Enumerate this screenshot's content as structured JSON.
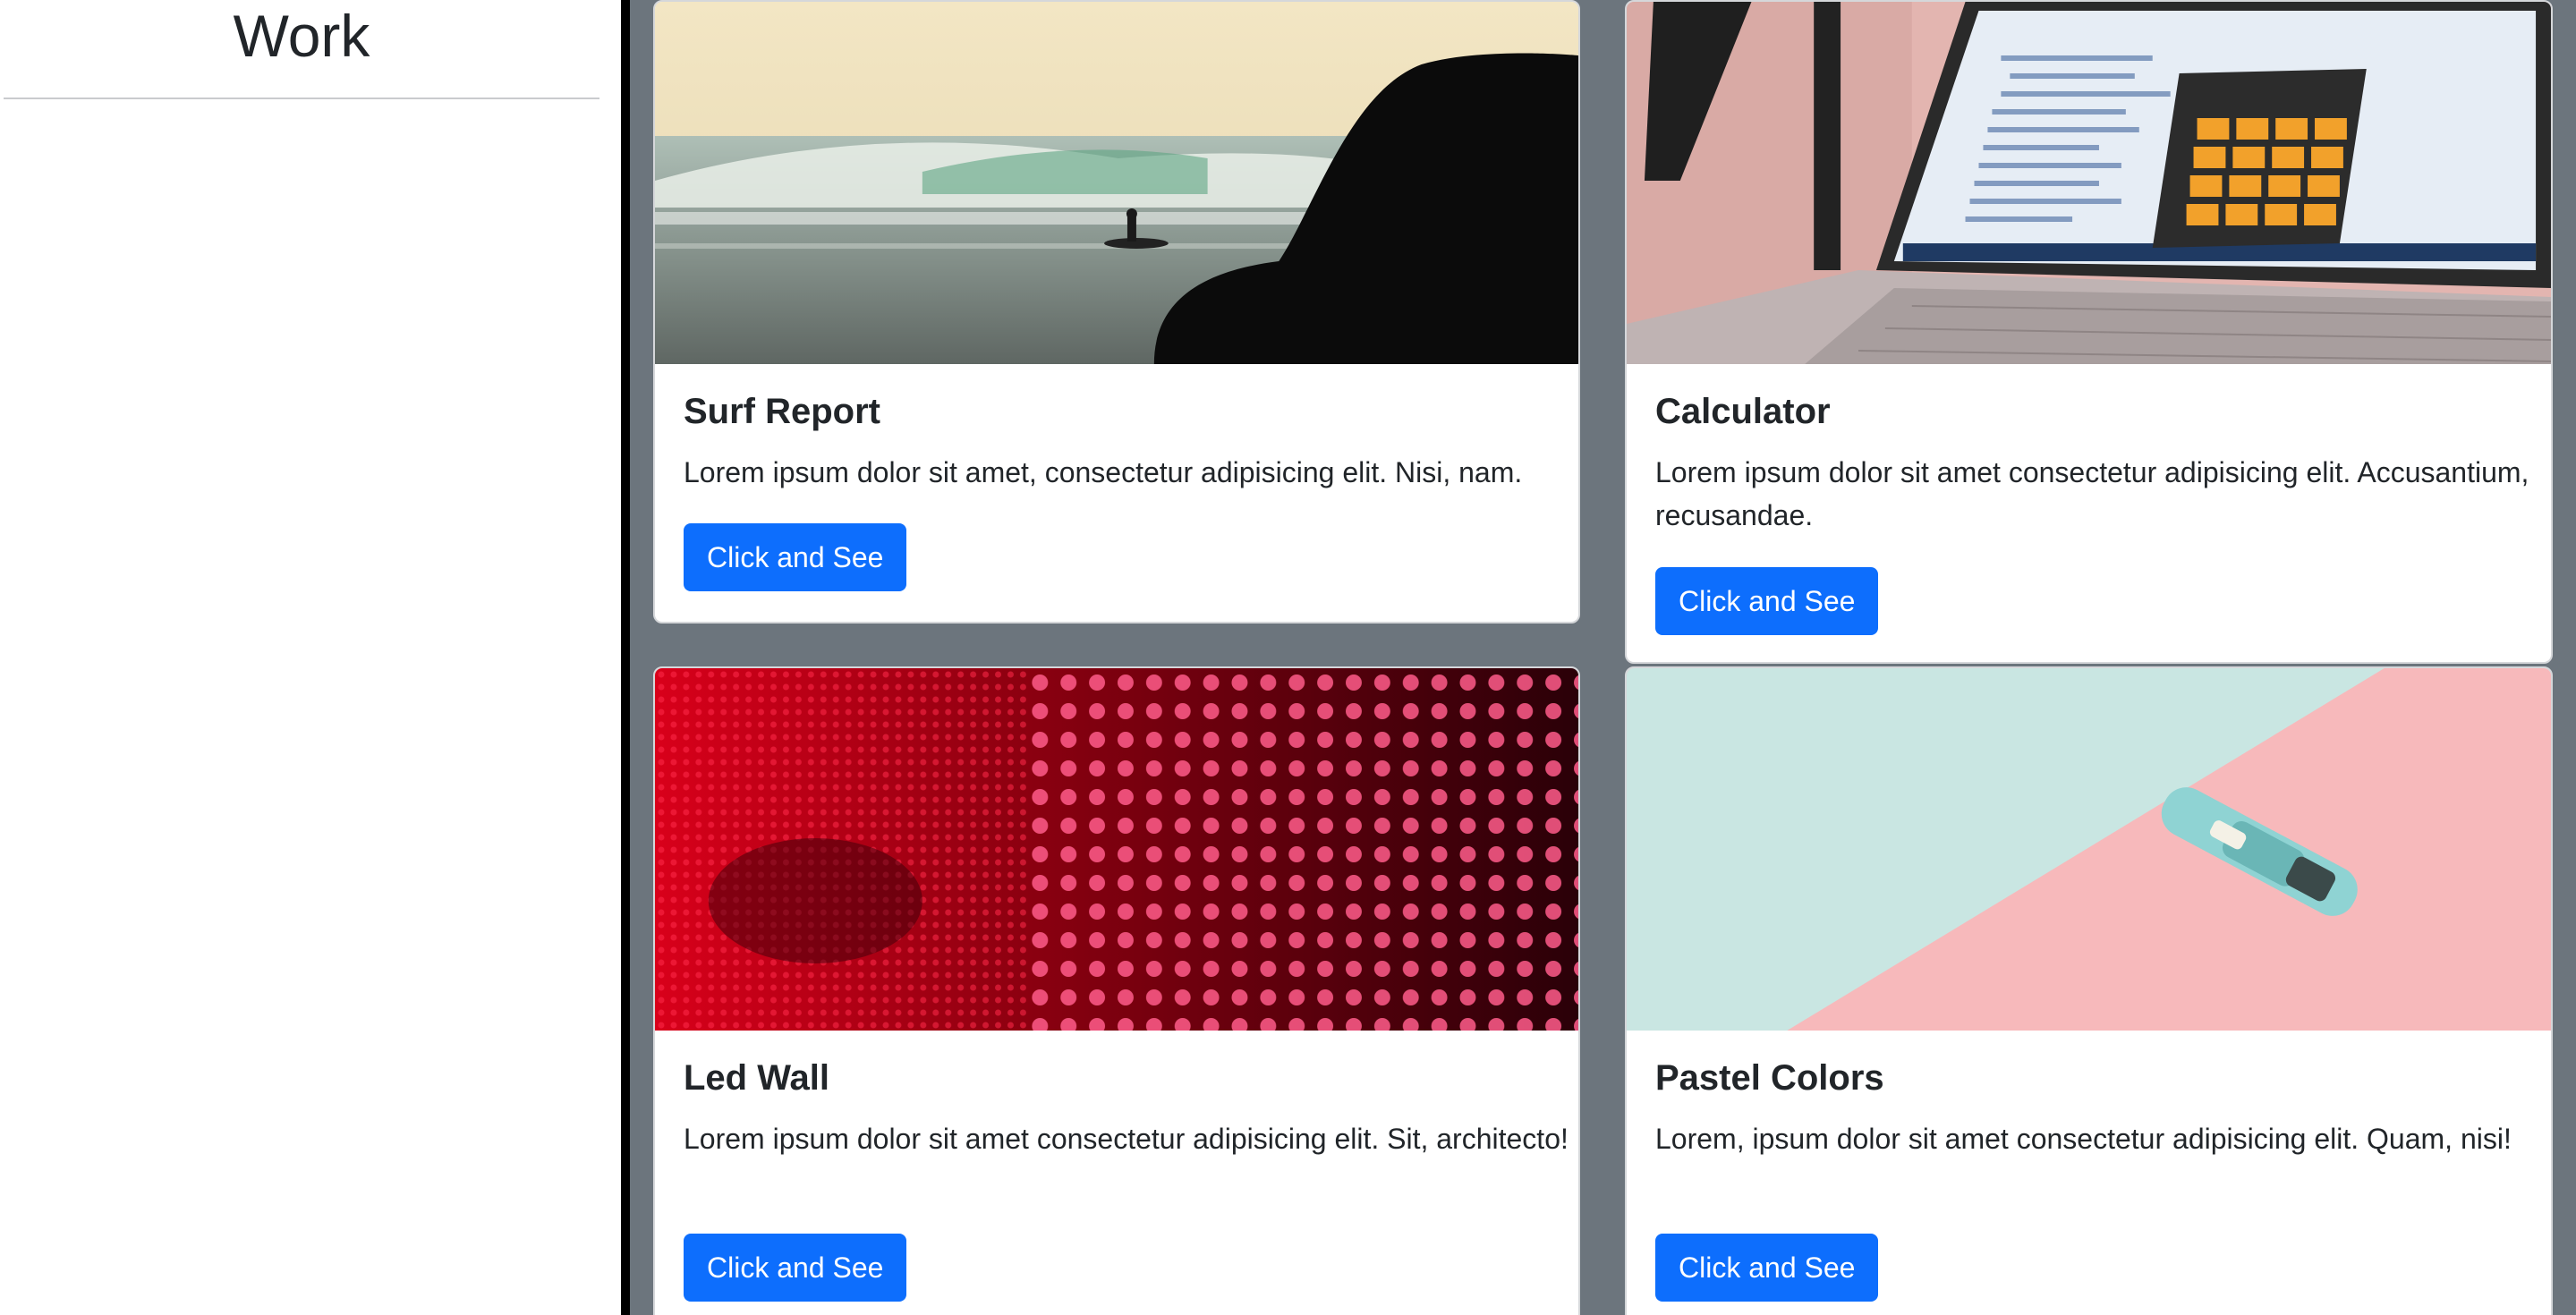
{
  "sidebar": {
    "title": "Work"
  },
  "cards": [
    {
      "title": "Surf Report",
      "text": "Lorem ipsum dolor sit amet, consectetur adipisicing elit. Nisi, nam.",
      "button": "Click and See"
    },
    {
      "title": "Calculator",
      "text": "Lorem ipsum dolor sit amet consectetur adipisicing elit. Accusantium, recusandae.",
      "button": "Click and See"
    },
    {
      "title": "Led Wall",
      "text": "Lorem ipsum dolor sit amet consectetur adipisicing elit. Sit, architecto!",
      "button": "Click and See"
    },
    {
      "title": "Pastel Colors",
      "text": "Lorem, ipsum dolor sit amet consectetur adipisicing elit. Quam, nisi!",
      "button": "Click and See"
    }
  ],
  "colors": {
    "main_background": "#6c757d",
    "button": "#0d6efd",
    "divider": "#000000"
  }
}
